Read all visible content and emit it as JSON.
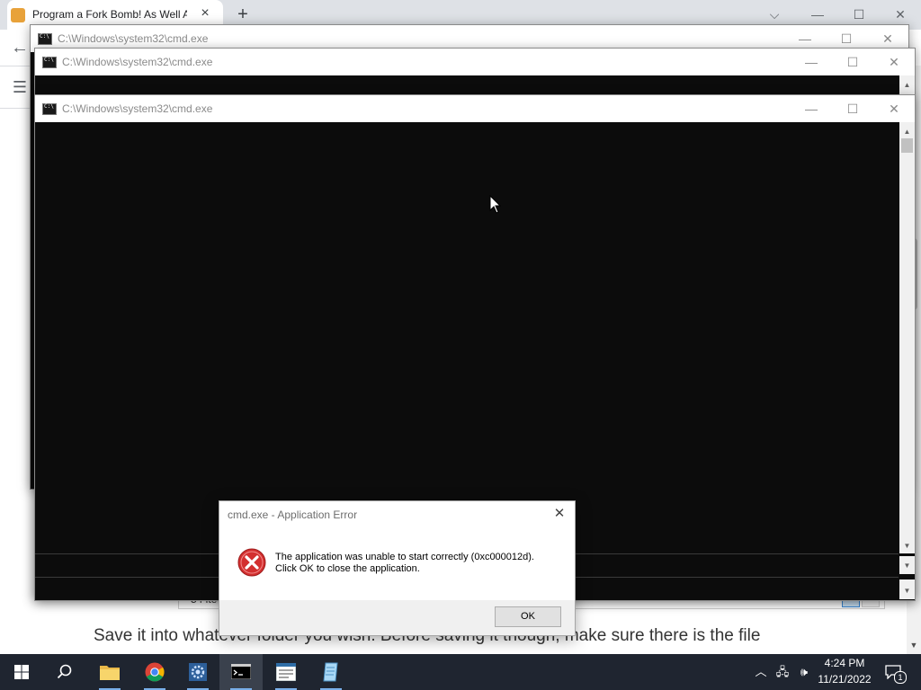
{
  "browser": {
    "tab_title": "Program a Fork Bomb! As Well A",
    "tab_close": "×",
    "new_tab": "+",
    "back": "←",
    "menu": "☰",
    "page_text": "Save it into whatever folder you wish. Before saving it though, make sure there is the file",
    "explorer_status_text": "54 ite"
  },
  "windows": [
    {
      "title": "C:\\Windows\\system32\\cmd.exe"
    },
    {
      "title": "C:\\Windows\\system32\\cmd.exe"
    },
    {
      "title": "C:\\Windows\\system32\\cmd.exe"
    }
  ],
  "window_controls": {
    "minimize": "—",
    "maximize": "☐",
    "close": "✕"
  },
  "dialog": {
    "title": "cmd.exe - Application Error",
    "close": "✕",
    "message_line1": "The application was unable to start correctly (0xc000012d).",
    "message_line2": "Click OK to close the application.",
    "ok_label": "OK"
  },
  "taskbar": {
    "time": "4:24 PM",
    "date": "11/21/2022",
    "notification_count": "1"
  },
  "colors": {
    "taskbar": "#1f2530",
    "console_bg": "#0c0c0c",
    "error_red": "#d32f2f"
  }
}
